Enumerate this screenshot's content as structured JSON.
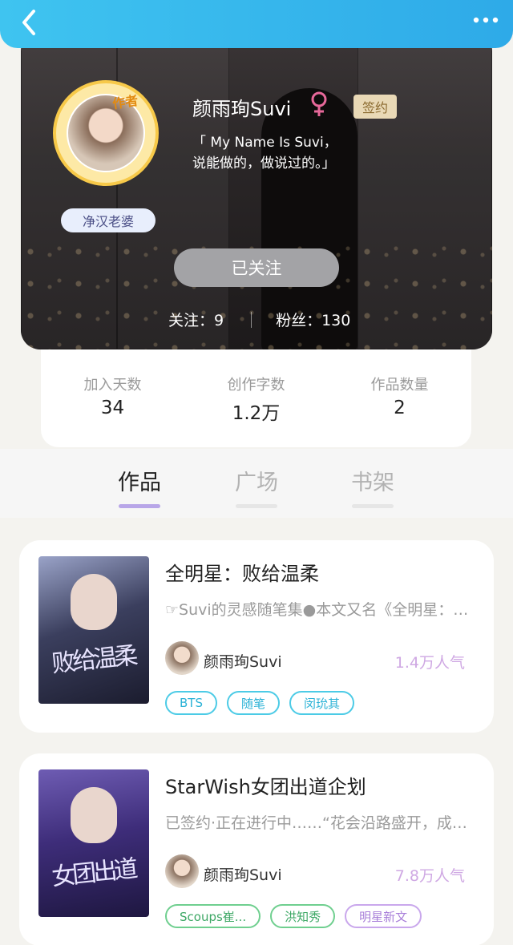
{
  "header": {
    "back_icon": "chevron-left-icon",
    "more_icon": "more-dots-icon"
  },
  "profile": {
    "name": "颜雨珣Suvi",
    "gender_icon": "female-icon",
    "author_tag": "作者",
    "sign_badge": "签约",
    "bio": "「 My Name Is Suvi，\n说能做的，做说过的。」",
    "nick_badge": "净汉老婆",
    "follow_button": "已关注",
    "following_label": "关注：9",
    "fans_label": "粉丝：130"
  },
  "stats": [
    {
      "label": "加入天数",
      "value": "34"
    },
    {
      "label": "创作字数",
      "value": "1.2万"
    },
    {
      "label": "作品数量",
      "value": "2"
    }
  ],
  "tabs": [
    {
      "label": "作品",
      "active": true
    },
    {
      "label": "广场",
      "active": false
    },
    {
      "label": "书架",
      "active": false
    }
  ],
  "books": [
    {
      "title": "全明星：败给温柔",
      "desc": "☞Suvi的灵感随笔集●本文又名《全明星：败给温柔》",
      "author": "颜雨珣Suvi",
      "popularity": "1.4万人气",
      "cover_text": "败给温柔",
      "tags": [
        {
          "label": "BTS",
          "color": "cyan"
        },
        {
          "label": "随笔",
          "color": "cyan"
        },
        {
          "label": "闵玧其",
          "color": "cyan"
        }
      ]
    },
    {
      "title": "StarWish女团出道企划",
      "desc": "已签约·正在进行中……“花会沿路盛开，成为星光",
      "author": "颜雨珣Suvi",
      "popularity": "7.8万人气",
      "cover_text": "女团出道",
      "tags": [
        {
          "label": "Scoups崔...",
          "color": "green"
        },
        {
          "label": "洪知秀",
          "color": "green"
        },
        {
          "label": "明星新文",
          "color": "purple"
        }
      ]
    }
  ],
  "colors": {
    "accent": "#2eaae8",
    "tab_active": "#b8a6e8",
    "popularity": "#cfa8e3"
  }
}
